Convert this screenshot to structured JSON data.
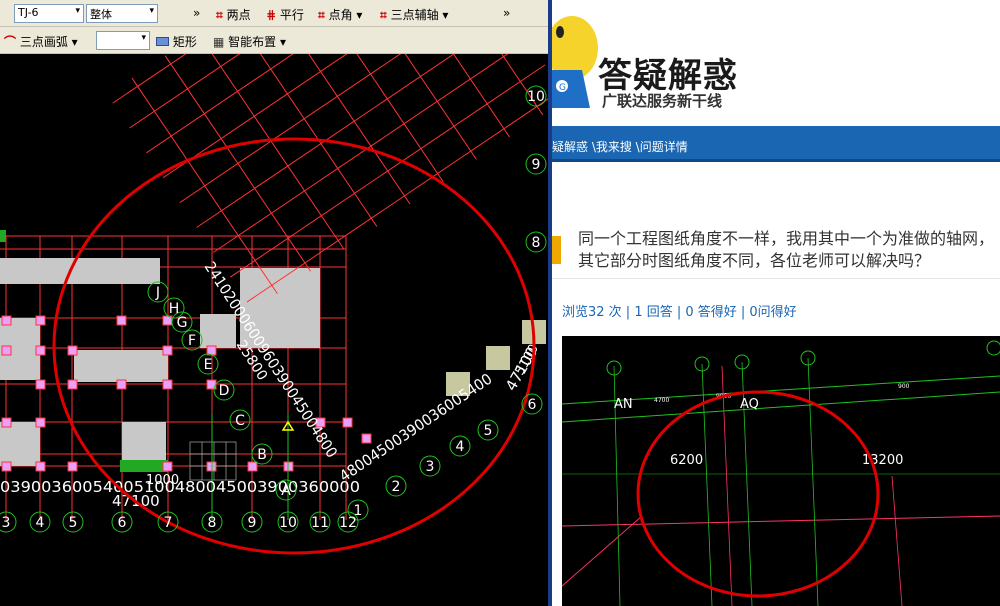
{
  "toolbar1": {
    "layer_value": "TJ-6",
    "scope_value": "整体",
    "two_points": "两点",
    "parallel": "平行",
    "point_angle": "点角",
    "three_point_axis": "三点辅轴",
    "more": "»"
  },
  "toolbar2": {
    "three_point_arc": "三点画弧",
    "rectangle": "矩形",
    "smart_layout": "智能布置",
    "more": "»"
  },
  "cad": {
    "bottom_axes": [
      "3",
      "4",
      "5",
      "6",
      "7",
      "8",
      "9",
      "10",
      "11",
      "12"
    ],
    "diag_axes": [
      "1",
      "2",
      "3",
      "4",
      "5",
      "6"
    ],
    "right_axes": [
      "8",
      "9",
      "10"
    ],
    "letter_axes": [
      "A",
      "B",
      "C",
      "D",
      "E",
      "F",
      "G",
      "H",
      "J"
    ],
    "bottom_dims": "03900360054005100480045003900360000",
    "bottom_total": "47100",
    "dim_1000": "1000",
    "diag_dims": "48004500390036005400",
    "diag_total": "47100",
    "diag_total_top": "5100",
    "vert_dims": "24102000600960390045004800",
    "vert_total": "25800"
  },
  "site": {
    "logo_title": "答疑解惑",
    "logo_subtitle": "广联达服务新干线",
    "breadcrumb": "疑解惑 \\我来搜 \\问题详情",
    "question": "同一个工程图纸角度不一样，我用其中一个为准做的轴网，其它部分时图纸角度不同，各位老师可以解决吗？",
    "stats": "浏览32 次 | 1 回答 | 0 答得好 | 0问得好"
  },
  "qimage": {
    "label_an": "AN",
    "label_aq": "AQ",
    "dim_left": "6200",
    "dim_right": "13200",
    "small_1": "4700",
    "small_2": "9900",
    "small_3": "900"
  },
  "colors": {
    "toolbar_bg": "#ece9d8",
    "grid_red": "#ff3333",
    "axis_green": "#1fc21f",
    "nav_blue": "#1a66b3",
    "circle_red": "#e00000"
  }
}
